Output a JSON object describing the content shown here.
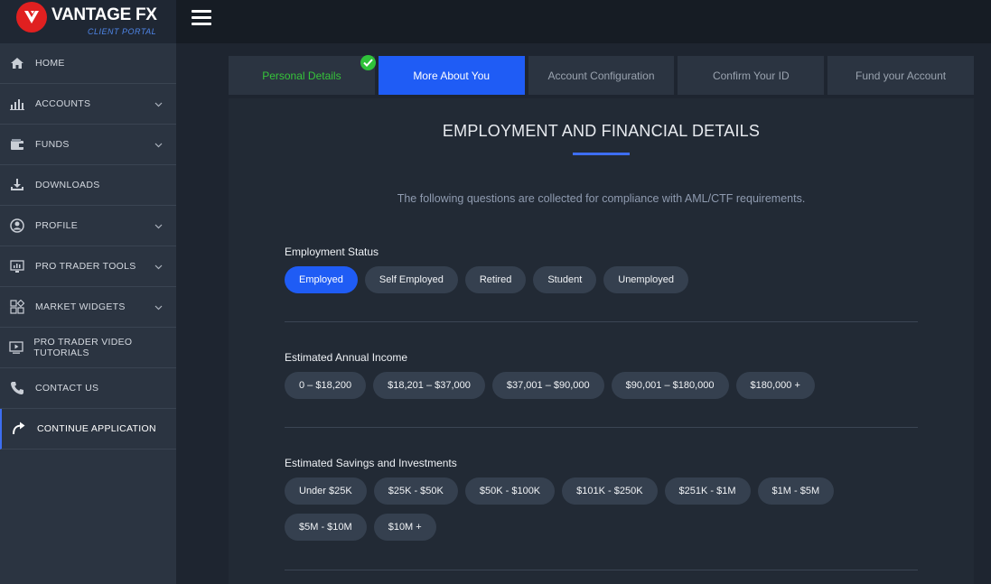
{
  "brand": {
    "name": "VANTAGE FX",
    "subtitle": "CLIENT PORTAL",
    "logo_color": "#e02020"
  },
  "sidebar": {
    "items": [
      {
        "label": "HOME",
        "icon": "home-icon",
        "has_chevron": false
      },
      {
        "label": "ACCOUNTS",
        "icon": "bar-chart-icon",
        "has_chevron": true
      },
      {
        "label": "FUNDS",
        "icon": "wallet-icon",
        "has_chevron": true
      },
      {
        "label": "DOWNLOADS",
        "icon": "download-icon",
        "has_chevron": false
      },
      {
        "label": "PROFILE",
        "icon": "user-icon",
        "has_chevron": true
      },
      {
        "label": "PRO TRADER TOOLS",
        "icon": "monitor-chart-icon",
        "has_chevron": true
      },
      {
        "label": "MARKET WIDGETS",
        "icon": "widgets-icon",
        "has_chevron": true
      },
      {
        "label": "PRO TRADER VIDEO TUTORIALS",
        "icon": "video-icon",
        "has_chevron": false
      },
      {
        "label": "CONTACT US",
        "icon": "phone-icon",
        "has_chevron": false
      },
      {
        "label": "CONTINUE APPLICATION",
        "icon": "redo-arrow-icon",
        "has_chevron": false,
        "active": true
      }
    ]
  },
  "tabs": [
    {
      "label": "Personal Details",
      "state": "completed"
    },
    {
      "label": "More About You",
      "state": "active"
    },
    {
      "label": "Account Configuration",
      "state": "pending"
    },
    {
      "label": "Confirm Your ID",
      "state": "pending"
    },
    {
      "label": "Fund your Account",
      "state": "pending"
    }
  ],
  "main": {
    "heading": "EMPLOYMENT AND FINANCIAL DETAILS",
    "intro": "The following questions are collected for compliance with AML/CTF requirements.",
    "sections": [
      {
        "label": "Employment Status",
        "options": [
          "Employed",
          "Self Employed",
          "Retired",
          "Student",
          "Unemployed"
        ],
        "selected": "Employed"
      },
      {
        "label": "Estimated Annual Income",
        "options": [
          "0 – $18,200",
          "$18,201 – $37,000",
          "$37,001 – $90,000",
          "$90,001 – $180,000",
          "$180,000 +"
        ],
        "selected": null
      },
      {
        "label": "Estimated Savings and Investments",
        "options": [
          "Under $25K",
          "$25K - $50K",
          "$50K - $100K",
          "$101K - $250K",
          "$251K - $1M",
          "$1M - $5M",
          "$5M - $10M",
          "$10M +"
        ],
        "selected": null
      }
    ]
  },
  "colors": {
    "accent": "#1f5cf5",
    "completed": "#36c43a",
    "sidebar_bg": "#2b3441",
    "panel_bg": "#222a35"
  }
}
